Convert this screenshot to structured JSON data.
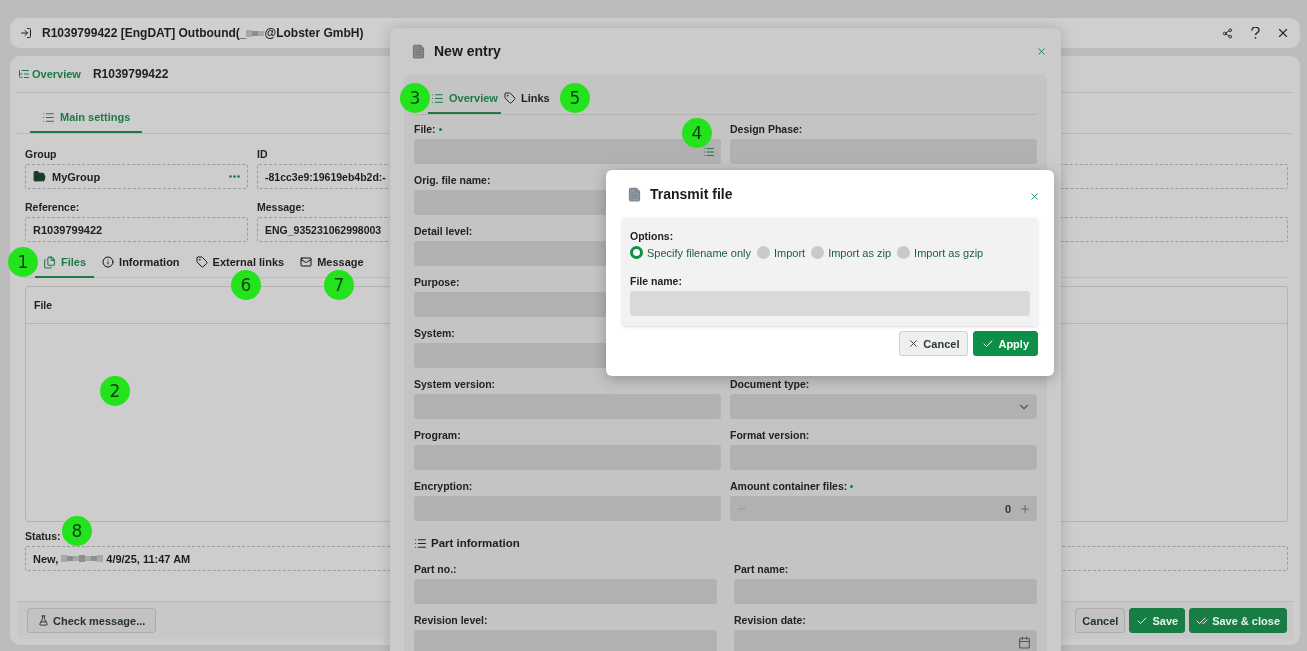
{
  "window": {
    "title_start": "R1039799422 [EngDAT] Outbound(_",
    "title_end": "@Lobster GmbH)"
  },
  "breadcrumb": {
    "link": "Overview",
    "current": "R1039799422"
  },
  "main_tabs": [
    {
      "label": "Main settings",
      "selected": true
    }
  ],
  "header_fields": [
    {
      "label": "Group",
      "value": "MyGroup",
      "kind": "group"
    },
    {
      "label": "ID",
      "value": "-81cc3e9:19619eb4b2d:-"
    },
    {
      "label": "Reference:",
      "value": "R1039799422"
    },
    {
      "label": "Message:",
      "value": "ENG_935231062998003"
    }
  ],
  "detail_tabs": [
    {
      "label": "Files",
      "selected": true
    },
    {
      "label": "Information",
      "selected": false
    },
    {
      "label": "External links",
      "selected": false
    },
    {
      "label": "Message",
      "selected": false
    }
  ],
  "files_table": {
    "columns": [
      "File"
    ]
  },
  "status": {
    "label": "Status:",
    "value_start": "New,",
    "value_end": "4/9/25, 11:47 AM"
  },
  "footer_buttons": [
    {
      "label": "Check message..."
    }
  ],
  "actions": [
    {
      "label": "Cancel",
      "kind": "secondary"
    },
    {
      "label": "Save",
      "kind": "primary"
    },
    {
      "label": "Save & close",
      "kind": "primary"
    }
  ],
  "entry_dialog": {
    "title": "New entry",
    "tabs": [
      {
        "label": "Overview",
        "selected": true
      },
      {
        "label": "Links",
        "selected": false
      }
    ],
    "rows": [
      {
        "left": {
          "label": "File:",
          "required": true,
          "kind": "file"
        },
        "right": {
          "label": "Design Phase:"
        }
      },
      {
        "left": {
          "label": "Orig. file name:"
        }
      },
      {
        "left": {
          "label": "Detail level:"
        }
      },
      {
        "left": {
          "label": "Purpose:"
        }
      },
      {
        "left": {
          "label": "System:"
        }
      },
      {
        "left": {
          "label": "System version:"
        },
        "right": {
          "label": "Document type:",
          "kind": "select"
        }
      },
      {
        "left": {
          "label": "Program:"
        },
        "right": {
          "label": "Format version:"
        }
      },
      {
        "left": {
          "label": "Encryption:"
        },
        "right": {
          "label": "Amount container files:",
          "required": true,
          "kind": "number",
          "value": "0"
        }
      }
    ],
    "section": "Part information",
    "part_rows": [
      {
        "left": {
          "label": "Part no.:"
        },
        "right": {
          "label": "Part name:"
        }
      },
      {
        "left": {
          "label": "Revision level:"
        },
        "right": {
          "label": "Revision date:",
          "kind": "date"
        }
      }
    ]
  },
  "transmit_dialog": {
    "title": "Transmit file",
    "options_label": "Options:",
    "options": [
      {
        "label": "Specify filename only",
        "selected": true
      },
      {
        "label": "Import",
        "selected": false
      },
      {
        "label": "Import as zip",
        "selected": false
      },
      {
        "label": "Import as gzip",
        "selected": false
      }
    ],
    "file_name_label": "File name:",
    "buttons": [
      {
        "label": "Cancel",
        "kind": "secondary"
      },
      {
        "label": "Apply",
        "kind": "primary"
      }
    ]
  },
  "callouts": [
    {
      "label": "1"
    },
    {
      "label": "2"
    },
    {
      "label": "3"
    },
    {
      "label": "4"
    },
    {
      "label": "5"
    },
    {
      "label": "6"
    },
    {
      "label": "7"
    },
    {
      "label": "8"
    }
  ]
}
